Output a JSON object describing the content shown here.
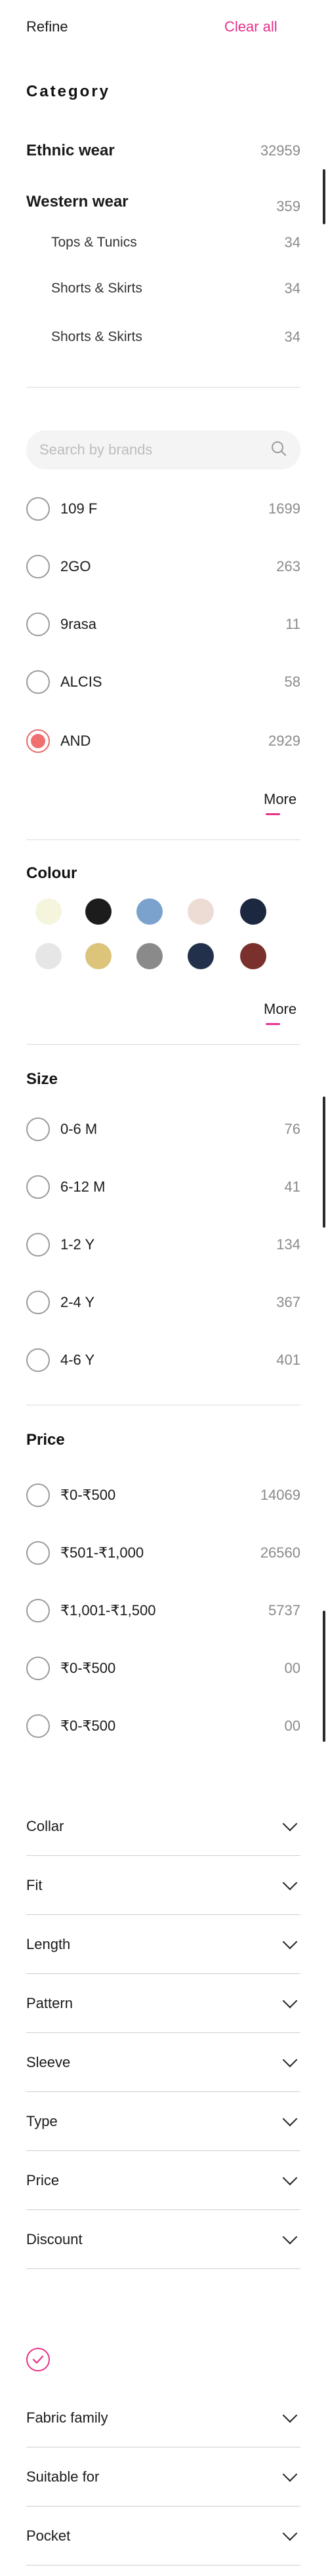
{
  "header": {
    "refine": "Refine",
    "clear_all": "Clear all"
  },
  "category": {
    "title": "Category",
    "items": [
      {
        "label": "Ethnic wear",
        "count": "32959"
      },
      {
        "label": "Western wear",
        "count": "359"
      },
      {
        "label": "Tops & Tunics",
        "count": "34"
      },
      {
        "label": "Shorts & Skirts",
        "count": "34"
      },
      {
        "label": "Shorts & Skirts",
        "count": "34"
      }
    ]
  },
  "brands": {
    "search_placeholder": "Search by brands",
    "items": [
      {
        "label": "109 F",
        "count": "1699"
      },
      {
        "label": "2GO",
        "count": "263"
      },
      {
        "label": "9rasa",
        "count": "11"
      },
      {
        "label": "ALCIS",
        "count": "58"
      },
      {
        "label": "AND",
        "count": "2929"
      }
    ],
    "more": "More"
  },
  "colour": {
    "title": "Colour",
    "swatches": [
      "#f4f5dc",
      "#1c1c1c",
      "#7aa2cc",
      "#eddcd4",
      "#1c2740",
      "#e6e6e6",
      "#dcc47a",
      "#8a8a8a",
      "#23304c",
      "#7a302c"
    ],
    "more": "More"
  },
  "size": {
    "title": "Size",
    "items": [
      {
        "label": "0-6 M",
        "count": "76"
      },
      {
        "label": "6-12 M",
        "count": "41"
      },
      {
        "label": "1-2 Y",
        "count": "134"
      },
      {
        "label": "2-4 Y",
        "count": "367"
      },
      {
        "label": "4-6 Y",
        "count": "401"
      }
    ]
  },
  "price": {
    "title": "Price",
    "items": [
      {
        "label": "₹0-₹500",
        "count": "14069"
      },
      {
        "label": "₹501-₹1,000",
        "count": "26560"
      },
      {
        "label": "₹1,001-₹1,500",
        "count": "5737"
      },
      {
        "label": "₹0-₹500",
        "count": "00"
      },
      {
        "label": "₹0-₹500",
        "count": "00"
      }
    ]
  },
  "accordions": [
    "Collar",
    "Fit",
    "Length",
    "Pattern",
    "Sleeve",
    "Type",
    "Price",
    "Discount"
  ],
  "accordions2": [
    "Fabric family",
    "Suitable for",
    "Pocket"
  ],
  "colors": {
    "accent": "#e8308a",
    "selected_radio": "#f07070"
  }
}
